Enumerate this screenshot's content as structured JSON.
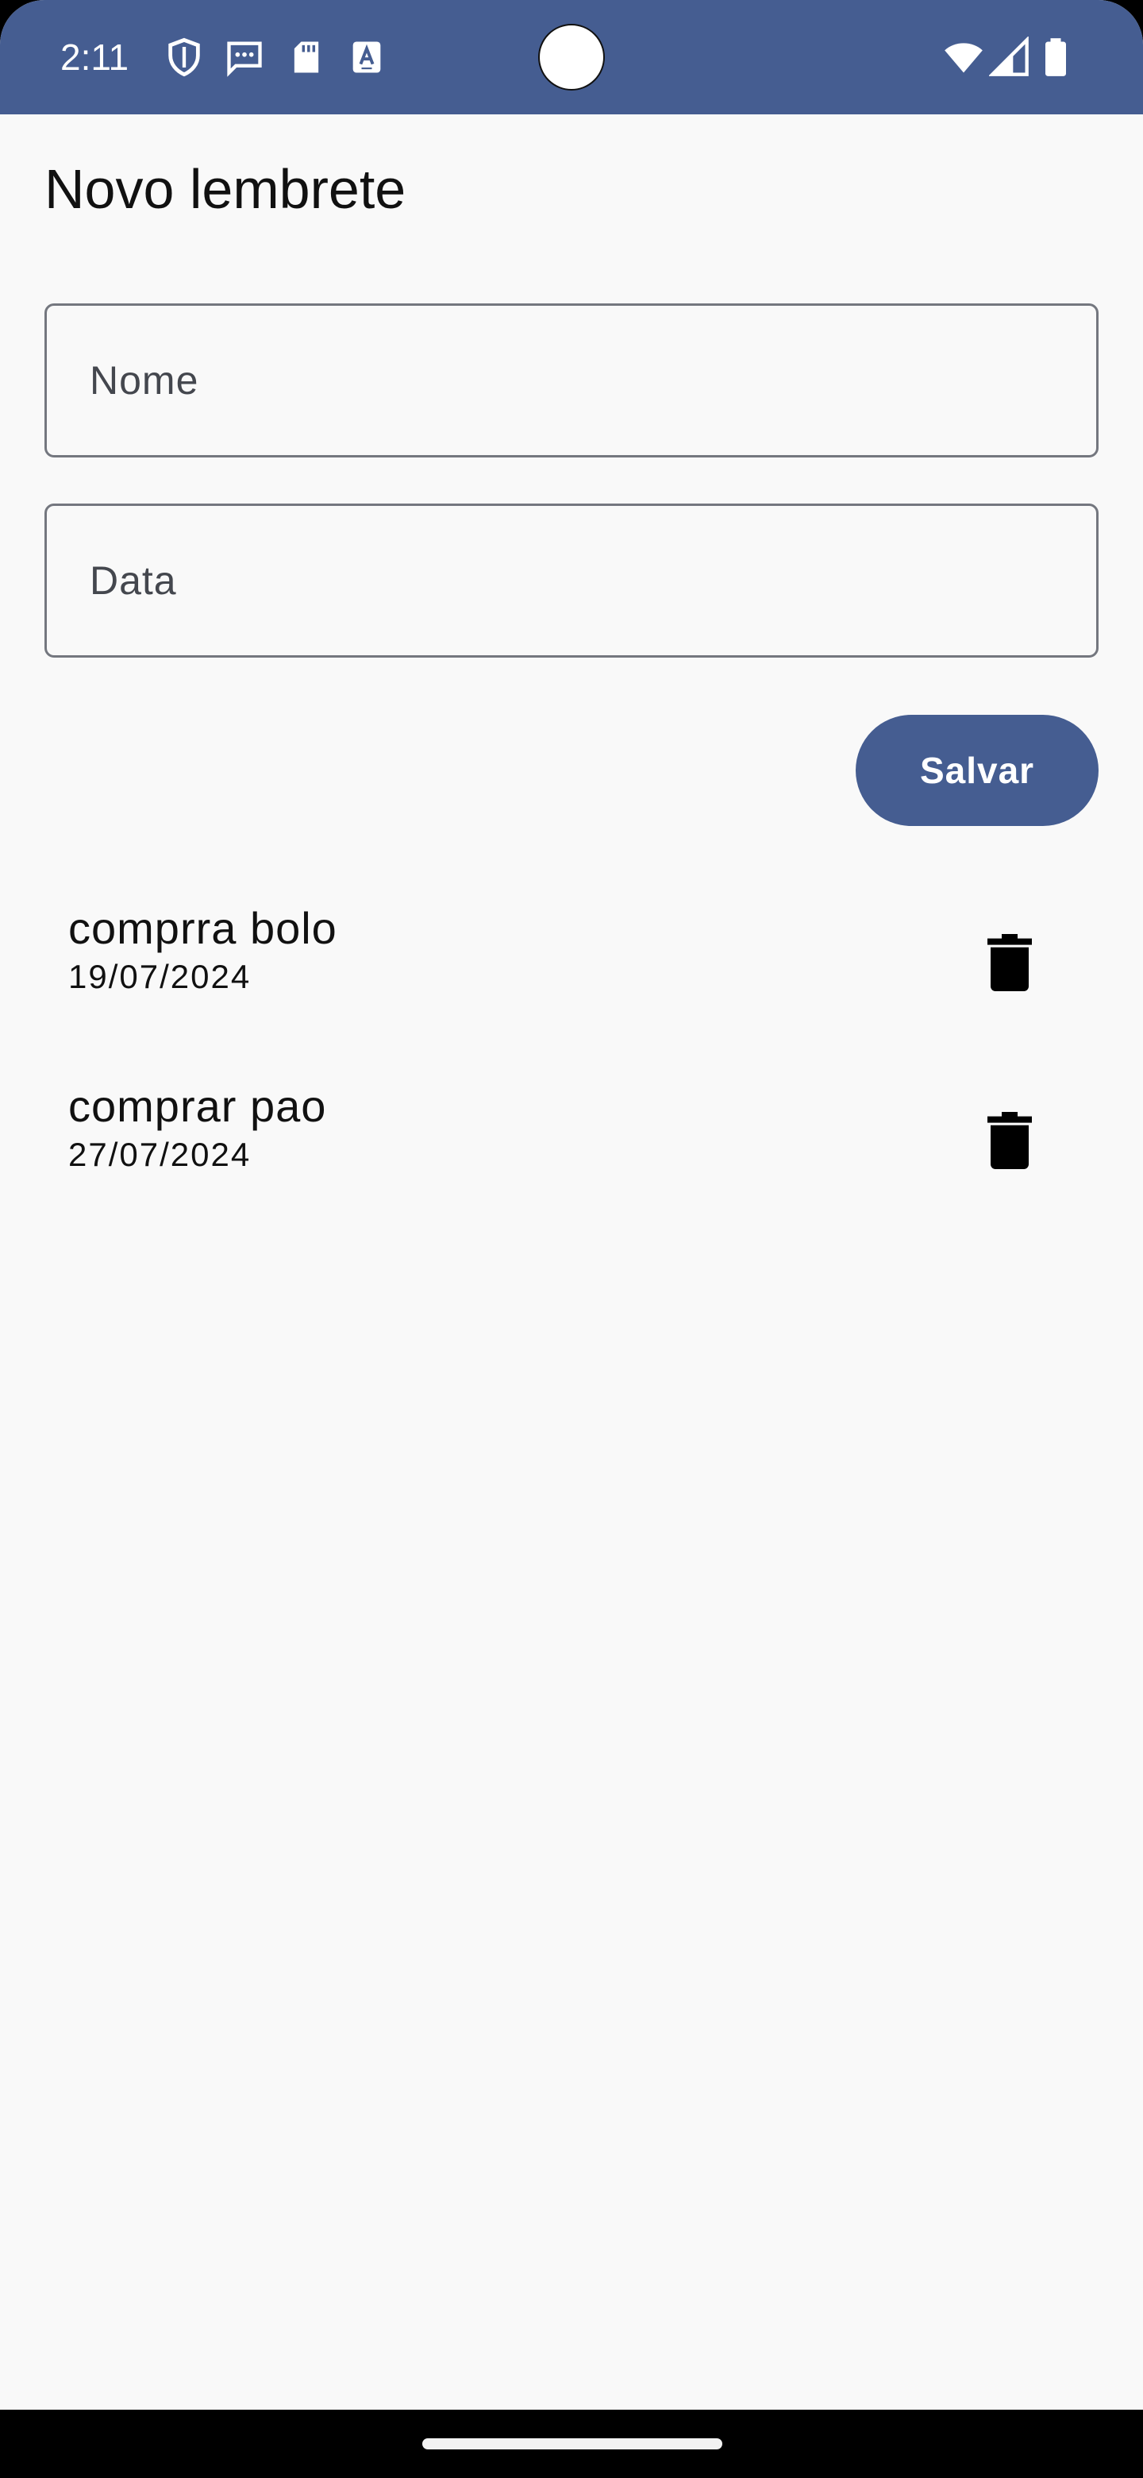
{
  "status_bar": {
    "time": "2:11",
    "background_color": "#455d91",
    "left_icons": [
      "shield-icon",
      "message-icon",
      "sd-card-icon",
      "text-a-icon"
    ],
    "right_icons": [
      "wifi-icon",
      "cellular-signal-icon",
      "battery-icon"
    ]
  },
  "page": {
    "title": "Novo lembrete"
  },
  "form": {
    "name_field": {
      "placeholder": "Nome",
      "value": ""
    },
    "date_field": {
      "placeholder": "Data",
      "value": ""
    },
    "save_label": "Salvar"
  },
  "reminders": [
    {
      "name": "comprra bolo",
      "date": "19/07/2024",
      "action_icon": "trash-icon"
    },
    {
      "name": "comprar pao",
      "date": "27/07/2024",
      "action_icon": "trash-icon"
    }
  ],
  "colors": {
    "primary": "#455d91",
    "background": "#f9f9f9",
    "outline": "#74777f"
  }
}
